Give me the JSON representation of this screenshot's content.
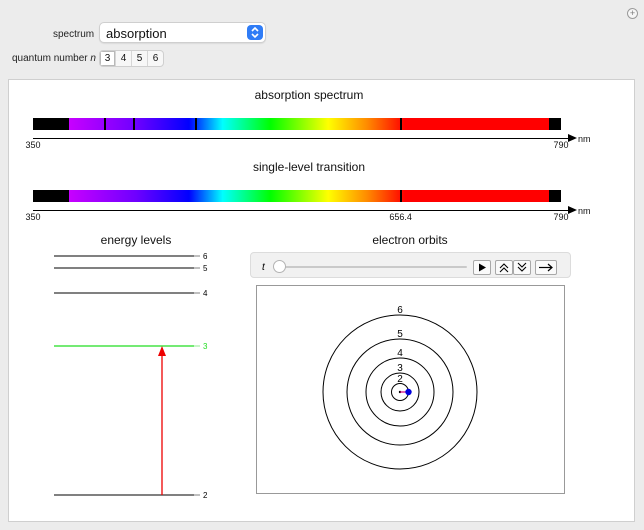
{
  "controls": {
    "spectrum_label": "spectrum",
    "spectrum_value": "absorption",
    "quantum_label": "quantum number",
    "quantum_symbol": "n",
    "quantum_options": [
      "3",
      "4",
      "5",
      "6"
    ],
    "quantum_selected": "3"
  },
  "corner_icon": "plus-icon",
  "spectra": {
    "absorption_title": "absorption spectrum",
    "single_title": "single-level transition",
    "x_min": 350,
    "x_max": 790,
    "x_min_label": "350",
    "x_max_label": "790",
    "unit": "nm",
    "absorption_lines_nm": [
      410.2,
      434.1,
      486.1,
      656.3
    ],
    "single_line_nm": 656.4,
    "single_line_label": "656.4",
    "visible_range_nm": [
      380,
      780
    ]
  },
  "energy": {
    "title": "energy levels",
    "levels": [
      {
        "n": 6,
        "label": "6"
      },
      {
        "n": 5,
        "label": "5"
      },
      {
        "n": 4,
        "label": "4"
      },
      {
        "n": 3,
        "label": "3",
        "highlight": true
      },
      {
        "n": 2,
        "label": "2"
      }
    ],
    "transition": {
      "from": 2,
      "to": 3
    },
    "highlight_color": "#22dd22",
    "arrow_color": "#ee0000"
  },
  "orbits": {
    "title": "electron orbits",
    "animator": {
      "t_label": "t",
      "t_value": 0,
      "play_icon": "play-icon",
      "faster_icon": "double-chevron-up-icon",
      "slower_icon": "double-chevron-down-icon",
      "direction_icon": "right-arrow-icon"
    },
    "shells": [
      {
        "n": 2,
        "label": "2"
      },
      {
        "n": 3,
        "label": "3"
      },
      {
        "n": 4,
        "label": "4"
      },
      {
        "n": 5,
        "label": "5"
      },
      {
        "n": 6,
        "label": "6"
      }
    ],
    "electron_shell": 2,
    "electron_color": "#0000dd",
    "nucleus": "nucleus-dot"
  }
}
